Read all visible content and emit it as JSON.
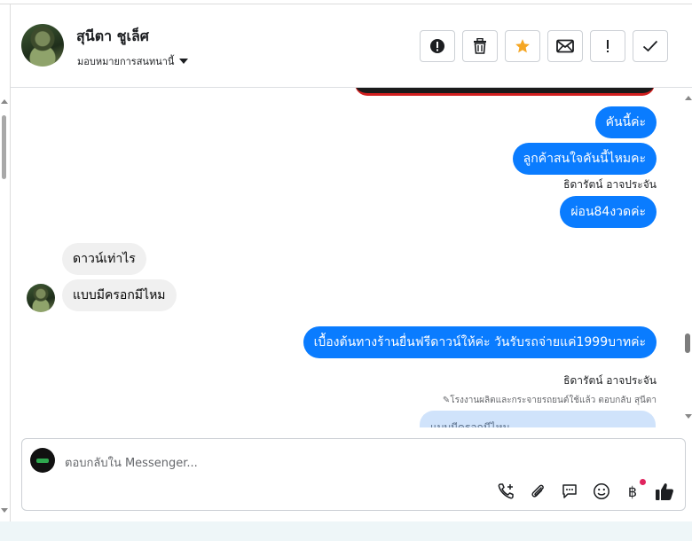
{
  "header": {
    "contact_name": "สุนีตา ชูเล็ศ",
    "assign_label": "มอบหมายการสนทนานี้",
    "actions": [
      {
        "icon": "alert-circle-icon",
        "label": "report"
      },
      {
        "icon": "trash-icon",
        "label": "delete"
      },
      {
        "icon": "star-icon",
        "label": "star",
        "color": "#f5a623"
      },
      {
        "icon": "envelope-icon",
        "label": "mark-unread"
      },
      {
        "icon": "exclamation-icon",
        "label": "important"
      },
      {
        "icon": "checkmark-icon",
        "label": "done"
      }
    ]
  },
  "messages": [
    {
      "direction": "out",
      "text": "คันนี้ค่ะ"
    },
    {
      "direction": "out",
      "text": "ลูกค้าสนใจคันนี้ไหมคะ"
    },
    {
      "direction": "out",
      "sender": "ธิดารัตน์ อาจประจัน",
      "text": "ผ่อน84งวดค่ะ"
    },
    {
      "direction": "in",
      "text": "ดาวน์เท่าไร"
    },
    {
      "direction": "in",
      "text": "แบบมีครอกมีไหม"
    },
    {
      "direction": "out",
      "text": "เบื้องต้นทางร้านยื่นฟรีดาวน์ให้ค่ะ วันรับรถจ่ายแค่1999บาทค่ะ"
    },
    {
      "direction": "out",
      "sender": "ธิดารัตน์ อาจประจัน",
      "reply_note": "โรงงานผลิตและกระจายรถยนต์ใช้แล้ว ตอบกลับ สุนีตา",
      "reply_preview": "แบบมีครอกมีไหม"
    }
  ],
  "composer": {
    "placeholder": "ตอบกลับใน Messenger...",
    "icons": [
      "phone-add-icon",
      "paperclip-icon",
      "chat-bubble-icon",
      "smiley-icon",
      "baht-icon",
      "thumbs-up-icon"
    ],
    "baht_symbol": "฿"
  },
  "colors": {
    "outgoing_bubble": "#0a7cff",
    "incoming_bubble": "#f0f0f0",
    "star": "#f5a623",
    "notification_dot": "#e0245e"
  }
}
